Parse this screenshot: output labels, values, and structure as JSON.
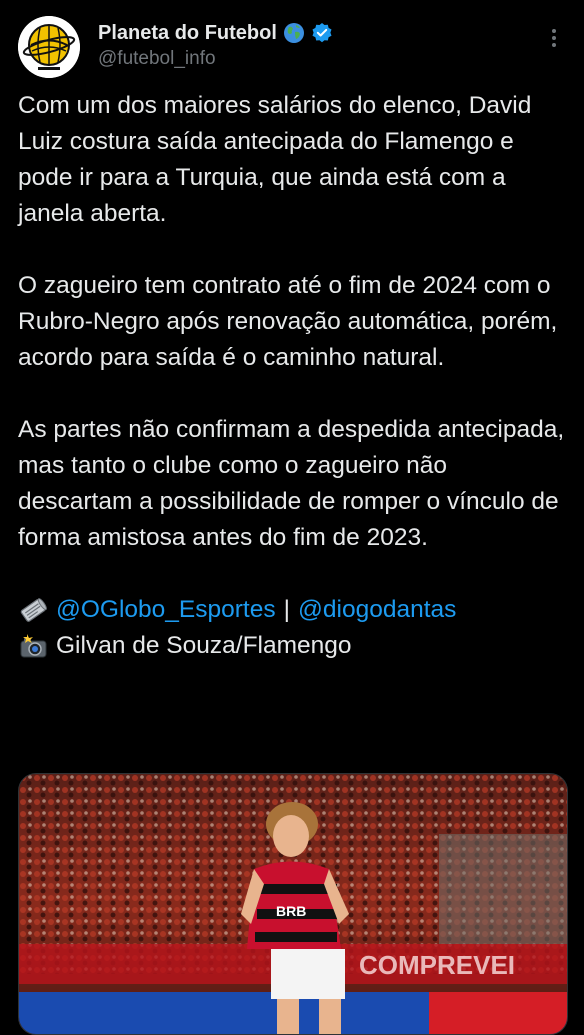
{
  "tweet": {
    "author": {
      "display_name": "Planeta do Futebol",
      "handle": "@futebol_info",
      "avatar_icon": "planeta-do-futebol-logo",
      "badge_icons": [
        "globe-icon",
        "verified-icon"
      ],
      "verified_color": "#1d9bf0"
    },
    "paragraphs": [
      "Com um dos maiores salários do elenco, David Luiz costura saída antecipada do Flamengo e pode ir para a Turquia, que ainda está com a janela aberta.",
      "O zagueiro tem contrato até o fim de 2024 com o Rubro-Negro após renovação automática, porém, acordo para saída é o caminho natural.",
      "As partes não confirmam a despedida antecipada, mas tanto o clube como o zagueiro não descartam a possibilidade de romper o vínculo de forma amistosa antes do fim de 2023."
    ],
    "source": {
      "icon": "newspaper-icon",
      "mention_1": "@OGlobo_Esportes",
      "separator": "|",
      "mention_2": "@diogodantas"
    },
    "photo_credit": {
      "icon": "camera-flash-icon",
      "text": "Gilvan de Souza/Flamengo"
    },
    "media": {
      "alt_icon": "photo-player-flamengo",
      "jersey_text": "BRB",
      "board_text": "COMPREVEI"
    }
  },
  "colors": {
    "background": "#000000",
    "text": "#e7e9ea",
    "secondary": "#71767b",
    "link": "#1d9bf0"
  }
}
